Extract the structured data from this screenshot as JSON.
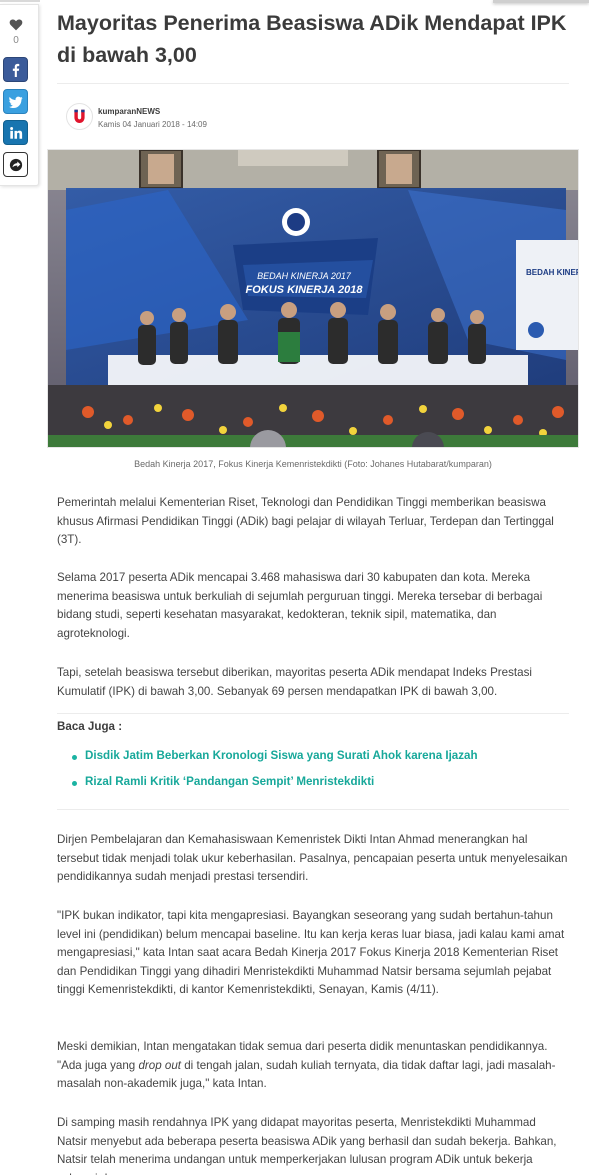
{
  "share": {
    "love_count": "0",
    "facebook_icon": "facebook-icon",
    "twitter_icon": "twitter-icon",
    "linkedin_icon": "linkedin-icon",
    "more_icon": "share-more-icon",
    "colors": {
      "facebook": "#3b5b9a",
      "twitter": "#3aa0e0",
      "linkedin": "#1875b0"
    }
  },
  "article": {
    "title": "Mayoritas Penerima Beasiswa ADik Mendapat IPK di bawah 3,00",
    "author": "kumparanNEWS",
    "date": "Kamis 04 Januari 2018 - 14:09",
    "image_caption": "Bedah Kinerja 2017, Fokus Kinerja Kemenristekdikti (Foto: Johanes Hutabarat/kumparan)",
    "paragraphs": [
      "Pemerintah melalui Kementerian Riset, Teknologi dan Pendidikan Tinggi memberikan beasiswa khusus Afirmasi Pendidikan Tinggi (ADik) bagi pelajar di wilayah Terluar, Terdepan dan Tertinggal (3T).",
      "Selama 2017 peserta ADik mencapai 3.468 mahasiswa dari 30 kabupaten dan kota. Mereka menerima beasiswa untuk  berkuliah di sejumlah perguruan tinggi. Mereka tersebar di berbagai bidang studi, seperti kesehatan masyarakat, kedokteran, teknik sipil, matematika, dan agroteknologi.",
      "Tapi, setelah beasiswa tersebut diberikan, mayoritas peserta ADik mendapat Indeks Prestasi Kumulatif (IPK) di bawah 3,00. Sebanyak 69 persen mendapatkan IPK di bawah 3,00.",
      "Dirjen Pembelajaran dan Kemahasiswaan Kemenristek Dikti Intan Ahmad menerangkan hal tersebut tidak menjadi tolak ukur keberhasilan. Pasalnya, pencapaian peserta untuk menyelesaikan pendidikannya sudah menjadi prestasi tersendiri.",
      "\"IPK bukan indikator, tapi kita mengapresiasi. Bayangkan seseorang yang sudah bertahun-tahun level ini (pendidikan) belum mencapai baseline. Itu kan kerja keras luar biasa, jadi kalau kami amat mengapresiasi,\" kata Intan saat acara Bedah Kinerja 2017 Fokus Kinerja 2018 Kementerian Riset dan Pendidikan Tinggi yang dihadiri Menristekdikti Muhammad Natsir bersama sejumlah pejabat tinggi Kemenristekdikti, di kantor Kemenristekdikti, Senayan, Kamis (4/11).",
      "Di samping masih rendahnya IPK yang didapat mayoritas peserta, Menristekdikti Muhammad Natsir menyebut ada beberapa peserta beasiswa ADik yang berhasil dan sudah bekerja. Bahkan, Natsir telah menerima undangan untuk memperkerjakan lulusan program ADik untuk bekerja sebagai dosen."
    ],
    "p6": {
      "before": "Meski demikian, Intan mengatakan tidak semua dari peserta didik menuntaskan pendidikannya. \"Ada juga yang ",
      "em": "drop out",
      "after": " di tengah jalan, sudah kuliah ternyata, dia tidak daftar lagi, jadi masalah-masalah non-akademik juga,\" kata Intan."
    },
    "baca_juga_label": "Baca Juga :",
    "related": [
      "Disdik Jatim Beberkan Kronologi Siswa yang Surati Ahok karena Ijazah",
      "Rizal Ramli Kritik ‘Pandangan Sempit’ Menristekdikti"
    ],
    "hero_image": {
      "banner_line1": "BEDAH KINERJA 2017",
      "banner_line2": "FOKUS KINERJA 2018",
      "side_text": "BEDAH KINERJA"
    },
    "accent_color": "#17a89a"
  }
}
